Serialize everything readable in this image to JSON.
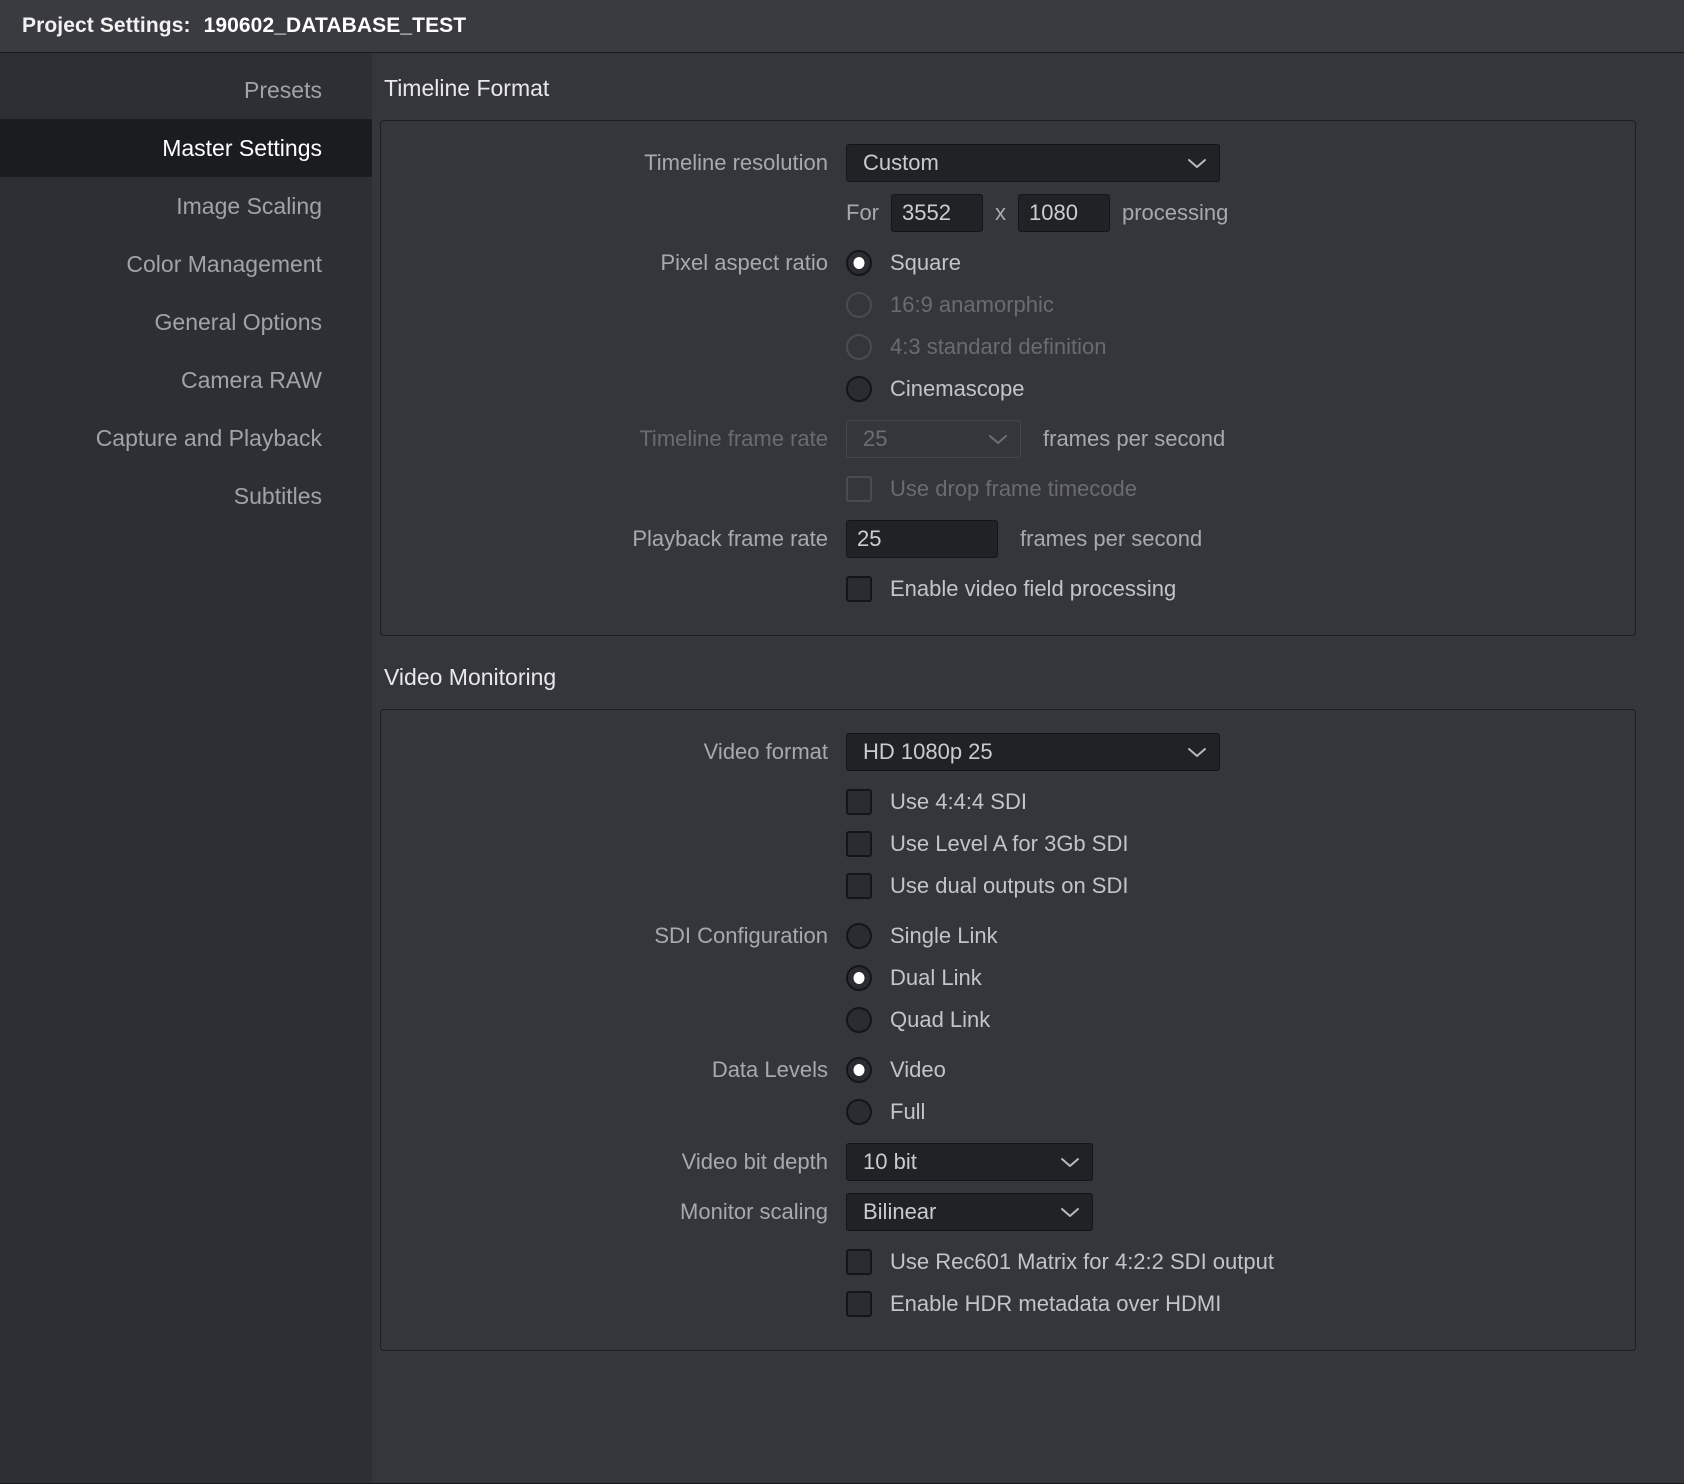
{
  "titlebar": {
    "label": "Project Settings:",
    "project_name": "190602_DATABASE_TEST"
  },
  "sidebar": {
    "items": [
      {
        "label": "Presets",
        "selected": false
      },
      {
        "label": "Master Settings",
        "selected": true
      },
      {
        "label": "Image Scaling",
        "selected": false
      },
      {
        "label": "Color Management",
        "selected": false
      },
      {
        "label": "General Options",
        "selected": false
      },
      {
        "label": "Camera RAW",
        "selected": false
      },
      {
        "label": "Capture and Playback",
        "selected": false
      },
      {
        "label": "Subtitles",
        "selected": false
      }
    ]
  },
  "timeline_format": {
    "section_title": "Timeline Format",
    "timeline_resolution": {
      "label": "Timeline resolution",
      "value": "Custom"
    },
    "custom_resolution": {
      "prefix": "For",
      "width": "3552",
      "separator": "x",
      "height": "1080",
      "suffix": "processing"
    },
    "pixel_aspect_ratio": {
      "label": "Pixel aspect ratio",
      "options": [
        {
          "label": "Square",
          "selected": true,
          "disabled": false
        },
        {
          "label": "16:9 anamorphic",
          "selected": false,
          "disabled": true
        },
        {
          "label": "4:3 standard definition",
          "selected": false,
          "disabled": true
        },
        {
          "label": "Cinemascope",
          "selected": false,
          "disabled": false
        }
      ]
    },
    "timeline_frame_rate": {
      "label": "Timeline frame rate",
      "value": "25",
      "units": "frames per second",
      "disabled": true
    },
    "use_drop_frame_timecode": {
      "label": "Use drop frame timecode",
      "checked": false,
      "disabled": true
    },
    "playback_frame_rate": {
      "label": "Playback frame rate",
      "value": "25",
      "units": "frames per second"
    },
    "enable_video_field_processing": {
      "label": "Enable video field processing",
      "checked": false
    }
  },
  "video_monitoring": {
    "section_title": "Video Monitoring",
    "video_format": {
      "label": "Video format",
      "value": "HD 1080p 25"
    },
    "use_444_sdi": {
      "label": "Use 4:4:4 SDI",
      "checked": false
    },
    "use_level_a_3gb_sdi": {
      "label": "Use Level A for 3Gb SDI",
      "checked": false
    },
    "use_dual_outputs_sdi": {
      "label": "Use dual outputs on SDI",
      "checked": false
    },
    "sdi_configuration": {
      "label": "SDI Configuration",
      "options": [
        {
          "label": "Single Link",
          "selected": false
        },
        {
          "label": "Dual Link",
          "selected": true
        },
        {
          "label": "Quad Link",
          "selected": false
        }
      ]
    },
    "data_levels": {
      "label": "Data Levels",
      "options": [
        {
          "label": "Video",
          "selected": true
        },
        {
          "label": "Full",
          "selected": false
        }
      ]
    },
    "video_bit_depth": {
      "label": "Video bit depth",
      "value": "10 bit"
    },
    "monitor_scaling": {
      "label": "Monitor scaling",
      "value": "Bilinear"
    },
    "use_rec601_matrix": {
      "label": "Use Rec601 Matrix for 4:2:2 SDI output",
      "checked": false
    },
    "enable_hdr_metadata": {
      "label": "Enable HDR metadata over HDMI",
      "checked": false
    }
  }
}
